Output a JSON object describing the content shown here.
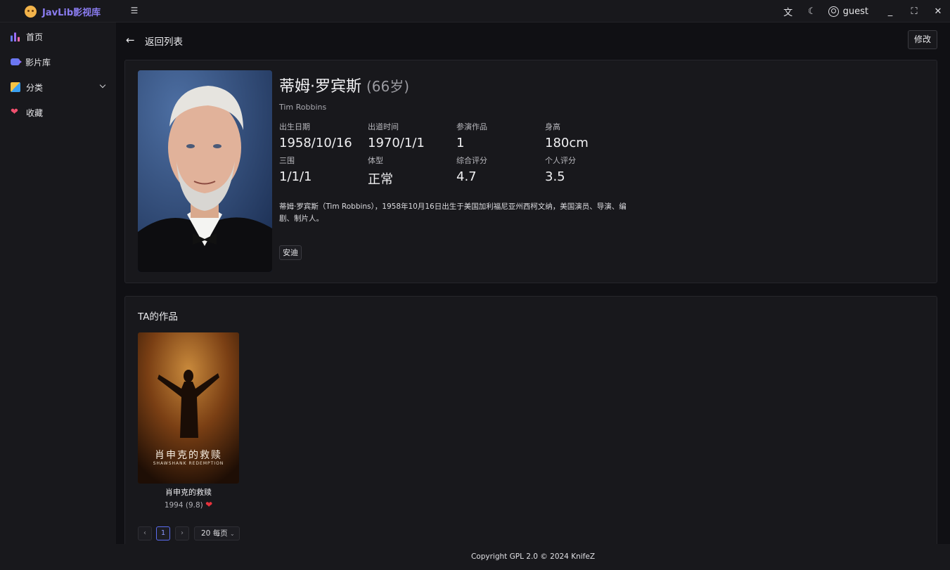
{
  "app": {
    "brand": "JavLib影视库"
  },
  "titlebar": {
    "username": "guest"
  },
  "sidebar": {
    "items": [
      {
        "label": "首页",
        "icon": "chart-icon"
      },
      {
        "label": "影片库",
        "icon": "video-icon"
      },
      {
        "label": "分类",
        "icon": "category-icon"
      },
      {
        "label": "收藏",
        "icon": "heart-icon"
      }
    ]
  },
  "header": {
    "back_label": "返回列表",
    "edit_label": "修改"
  },
  "actor": {
    "name": "蒂姆·罗宾斯",
    "age": "(66岁)",
    "en_name": "Tim Robbins",
    "stats": [
      {
        "label": "出生日期",
        "value": "1958/10/16"
      },
      {
        "label": "出道时间",
        "value": "1970/1/1"
      },
      {
        "label": "参演作品",
        "value": "1"
      },
      {
        "label": "身高",
        "value": "180cm"
      },
      {
        "label": "三围",
        "value": "1/1/1"
      },
      {
        "label": "体型",
        "value": "正常"
      },
      {
        "label": "综合评分",
        "value": "4.7"
      },
      {
        "label": "个人评分",
        "value": "3.5"
      }
    ],
    "bio": "蒂姆·罗宾斯（Tim Robbins），1958年10月16日出生于美国加利福尼亚州西柯文纳，美国演员、导演、编剧、制片人。",
    "tag": "安迪"
  },
  "works": {
    "title": "TA的作品",
    "items": [
      {
        "poster_title_cn": "肖申克的救赎",
        "poster_title_en": "SHAWSHANK REDEMPTION",
        "name": "肖申克的救赎",
        "meta": "1994 (9.8)"
      }
    ]
  },
  "pagination": {
    "current": "1",
    "page_size": "20 每页"
  },
  "footer": {
    "copyright": "Copyright GPL 2.0 © 2024 KnifeZ"
  },
  "colors": {
    "accent": "#5b6cf0",
    "brand": "#8a7cf0",
    "heart": "#e8323c"
  }
}
